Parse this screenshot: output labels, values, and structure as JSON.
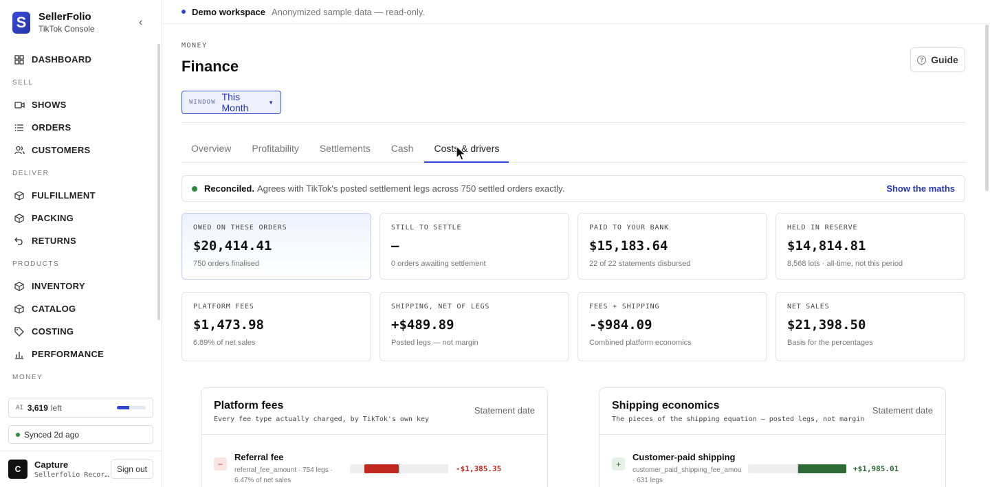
{
  "brand": {
    "name": "SellerFolio",
    "subtitle": "TikTok Console",
    "logo_letter": "S"
  },
  "sidebar": {
    "dashboard": {
      "label": "DASHBOARD",
      "icon": "grid-icon"
    },
    "sections": [
      {
        "title": "SELL",
        "items": [
          {
            "label": "SHOWS",
            "icon": "video-icon"
          },
          {
            "label": "ORDERS",
            "icon": "list-icon"
          },
          {
            "label": "CUSTOMERS",
            "icon": "users-icon"
          }
        ]
      },
      {
        "title": "DELIVER",
        "items": [
          {
            "label": "FULFILLMENT",
            "icon": "box-icon"
          },
          {
            "label": "PACKING",
            "icon": "box-icon"
          },
          {
            "label": "RETURNS",
            "icon": "return-arrow-icon"
          }
        ]
      },
      {
        "title": "PRODUCTS",
        "items": [
          {
            "label": "INVENTORY",
            "icon": "box-icon"
          },
          {
            "label": "CATALOG",
            "icon": "box-icon"
          },
          {
            "label": "COSTING",
            "icon": "tag-icon"
          },
          {
            "label": "PERFORMANCE",
            "icon": "bar-chart-icon"
          }
        ]
      },
      {
        "title": "MONEY",
        "items": []
      }
    ],
    "ai_credits": {
      "tag": "AI",
      "value": "3,619",
      "suffix": "left",
      "level": 0.42
    },
    "sync_status": "Synced 2d ago",
    "user": {
      "initial": "C",
      "name": "Capture",
      "sub": "Sellerfolio Recor…",
      "signout_label": "Sign out"
    }
  },
  "topbar": {
    "title": "Demo workspace",
    "subtitle": "Anonymized sample data — read-only."
  },
  "header": {
    "eyebrow": "MONEY",
    "title": "Finance",
    "guide_label": "Guide"
  },
  "window_select": {
    "tag": "WINDOW",
    "value": "This Month"
  },
  "tabs": [
    {
      "label": "Overview",
      "active": false
    },
    {
      "label": "Profitability",
      "active": false
    },
    {
      "label": "Settlements",
      "active": false
    },
    {
      "label": "Cash",
      "active": false
    },
    {
      "label": "Costs & drivers",
      "active": true
    }
  ],
  "reconciled": {
    "strong": "Reconciled.",
    "text": "Agrees with TikTok's posted settlement legs across 750 settled orders exactly.",
    "link": "Show the maths"
  },
  "kpis": [
    {
      "label": "OWED ON THESE ORDERS",
      "value": "$20,414.41",
      "sub": "750 orders finalised"
    },
    {
      "label": "STILL TO SETTLE",
      "value": "—",
      "sub": "0 orders awaiting settlement"
    },
    {
      "label": "PAID TO YOUR BANK",
      "value": "$15,183.64",
      "sub": "22 of 22 statements disbursed"
    },
    {
      "label": "HELD IN RESERVE",
      "value": "$14,814.81",
      "sub": "8,568 lots · all-time, not this period"
    },
    {
      "label": "PLATFORM FEES",
      "value": "$1,473.98",
      "sub": "6.89% of net sales"
    },
    {
      "label": "SHIPPING, NET OF LEGS",
      "value": "+$489.89",
      "sub": "Posted legs — not margin"
    },
    {
      "label": "FEES + SHIPPING",
      "value": "-$984.09",
      "sub": "Combined platform economics"
    },
    {
      "label": "NET SALES",
      "value": "$21,398.50",
      "sub": "Basis for the percentages"
    }
  ],
  "platform_fees": {
    "title": "Platform fees",
    "subtitle": "Every fee type actually charged, by TikTok's own key",
    "filter": "Statement date",
    "rows": [
      {
        "badge": "−",
        "title": "Referral fee",
        "sub": "referral_fee_amount · 754 legs · 6.47% of net sales",
        "value": "-$1,385.35",
        "amount": -1385.35,
        "color": "#c0271e"
      }
    ]
  },
  "shipping": {
    "title": "Shipping economics",
    "subtitle": "The pieces of the shipping equation — posted legs, not margin",
    "filter": "Statement date",
    "rows": [
      {
        "badge": "+",
        "title": "Customer-paid shipping",
        "sub": "customer_paid_shipping_fee_amou · 631 legs",
        "value": "+$1,985.01",
        "amount": 1985.01,
        "color": "#2e6b35"
      }
    ]
  }
}
